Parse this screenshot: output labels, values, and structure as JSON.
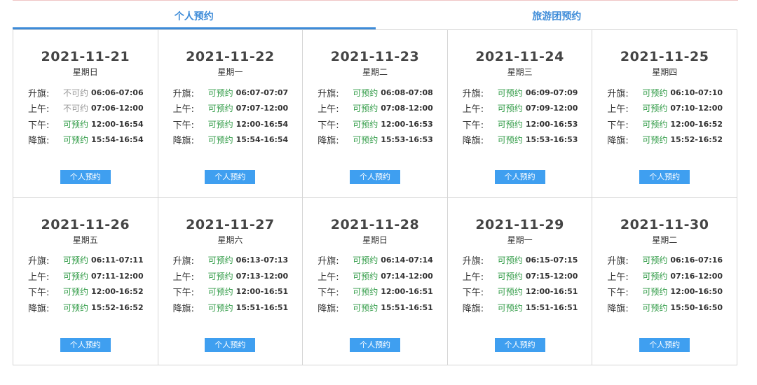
{
  "tabs": [
    {
      "label": "个人预约",
      "active": true
    },
    {
      "label": "旅游团预约",
      "active": false
    }
  ],
  "colors": {
    "accent": "#3d8bd8",
    "available": "#2e9a44",
    "unavailable": "#999999",
    "button": "#3f9ff0"
  },
  "button_label": "个人预约",
  "days": [
    {
      "date": "2021-11-21",
      "weekday": "星期日",
      "slots": [
        {
          "name": "升旗:",
          "status": "不可约",
          "available": false,
          "time": "06:06-07:06"
        },
        {
          "name": "上午:",
          "status": "不可约",
          "available": false,
          "time": "07:06-12:00"
        },
        {
          "name": "下午:",
          "status": "可预约",
          "available": true,
          "time": "12:00-16:54"
        },
        {
          "name": "降旗:",
          "status": "可预约",
          "available": true,
          "time": "15:54-16:54"
        }
      ]
    },
    {
      "date": "2021-11-22",
      "weekday": "星期一",
      "slots": [
        {
          "name": "升旗:",
          "status": "可预约",
          "available": true,
          "time": "06:07-07:07"
        },
        {
          "name": "上午:",
          "status": "可预约",
          "available": true,
          "time": "07:07-12:00"
        },
        {
          "name": "下午:",
          "status": "可预约",
          "available": true,
          "time": "12:00-16:54"
        },
        {
          "name": "降旗:",
          "status": "可预约",
          "available": true,
          "time": "15:54-16:54"
        }
      ]
    },
    {
      "date": "2021-11-23",
      "weekday": "星期二",
      "slots": [
        {
          "name": "升旗:",
          "status": "可预约",
          "available": true,
          "time": "06:08-07:08"
        },
        {
          "name": "上午:",
          "status": "可预约",
          "available": true,
          "time": "07:08-12:00"
        },
        {
          "name": "下午:",
          "status": "可预约",
          "available": true,
          "time": "12:00-16:53"
        },
        {
          "name": "降旗:",
          "status": "可预约",
          "available": true,
          "time": "15:53-16:53"
        }
      ]
    },
    {
      "date": "2021-11-24",
      "weekday": "星期三",
      "slots": [
        {
          "name": "升旗:",
          "status": "可预约",
          "available": true,
          "time": "06:09-07:09"
        },
        {
          "name": "上午:",
          "status": "可预约",
          "available": true,
          "time": "07:09-12:00"
        },
        {
          "name": "下午:",
          "status": "可预约",
          "available": true,
          "time": "12:00-16:53"
        },
        {
          "name": "降旗:",
          "status": "可预约",
          "available": true,
          "time": "15:53-16:53"
        }
      ]
    },
    {
      "date": "2021-11-25",
      "weekday": "星期四",
      "slots": [
        {
          "name": "升旗:",
          "status": "可预约",
          "available": true,
          "time": "06:10-07:10"
        },
        {
          "name": "上午:",
          "status": "可预约",
          "available": true,
          "time": "07:10-12:00"
        },
        {
          "name": "下午:",
          "status": "可预约",
          "available": true,
          "time": "12:00-16:52"
        },
        {
          "name": "降旗:",
          "status": "可预约",
          "available": true,
          "time": "15:52-16:52"
        }
      ]
    },
    {
      "date": "2021-11-26",
      "weekday": "星期五",
      "slots": [
        {
          "name": "升旗:",
          "status": "可预约",
          "available": true,
          "time": "06:11-07:11"
        },
        {
          "name": "上午:",
          "status": "可预约",
          "available": true,
          "time": "07:11-12:00"
        },
        {
          "name": "下午:",
          "status": "可预约",
          "available": true,
          "time": "12:00-16:52"
        },
        {
          "name": "降旗:",
          "status": "可预约",
          "available": true,
          "time": "15:52-16:52"
        }
      ]
    },
    {
      "date": "2021-11-27",
      "weekday": "星期六",
      "slots": [
        {
          "name": "升旗:",
          "status": "可预约",
          "available": true,
          "time": "06:13-07:13"
        },
        {
          "name": "上午:",
          "status": "可预约",
          "available": true,
          "time": "07:13-12:00"
        },
        {
          "name": "下午:",
          "status": "可预约",
          "available": true,
          "time": "12:00-16:51"
        },
        {
          "name": "降旗:",
          "status": "可预约",
          "available": true,
          "time": "15:51-16:51"
        }
      ]
    },
    {
      "date": "2021-11-28",
      "weekday": "星期日",
      "slots": [
        {
          "name": "升旗:",
          "status": "可预约",
          "available": true,
          "time": "06:14-07:14"
        },
        {
          "name": "上午:",
          "status": "可预约",
          "available": true,
          "time": "07:14-12:00"
        },
        {
          "name": "下午:",
          "status": "可预约",
          "available": true,
          "time": "12:00-16:51"
        },
        {
          "name": "降旗:",
          "status": "可预约",
          "available": true,
          "time": "15:51-16:51"
        }
      ]
    },
    {
      "date": "2021-11-29",
      "weekday": "星期一",
      "slots": [
        {
          "name": "升旗:",
          "status": "可预约",
          "available": true,
          "time": "06:15-07:15"
        },
        {
          "name": "上午:",
          "status": "可预约",
          "available": true,
          "time": "07:15-12:00"
        },
        {
          "name": "下午:",
          "status": "可预约",
          "available": true,
          "time": "12:00-16:51"
        },
        {
          "name": "降旗:",
          "status": "可预约",
          "available": true,
          "time": "15:51-16:51"
        }
      ]
    },
    {
      "date": "2021-11-30",
      "weekday": "星期二",
      "slots": [
        {
          "name": "升旗:",
          "status": "可预约",
          "available": true,
          "time": "06:16-07:16"
        },
        {
          "name": "上午:",
          "status": "可预约",
          "available": true,
          "time": "07:16-12:00"
        },
        {
          "name": "下午:",
          "status": "可预约",
          "available": true,
          "time": "12:00-16:50"
        },
        {
          "name": "降旗:",
          "status": "可预约",
          "available": true,
          "time": "15:50-16:50"
        }
      ]
    }
  ]
}
